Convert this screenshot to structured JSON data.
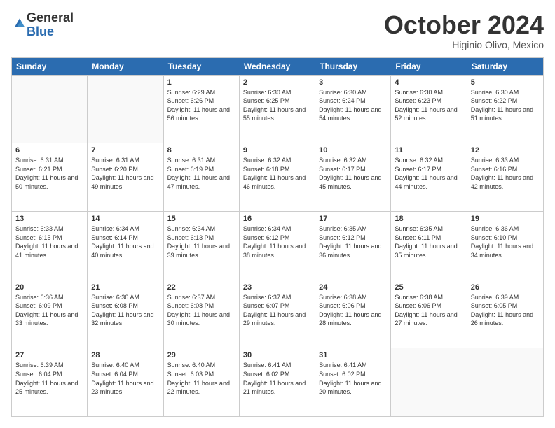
{
  "logo": {
    "general": "General",
    "blue": "Blue"
  },
  "title": "October 2024",
  "location": "Higinio Olivo, Mexico",
  "header_days": [
    "Sunday",
    "Monday",
    "Tuesday",
    "Wednesday",
    "Thursday",
    "Friday",
    "Saturday"
  ],
  "rows": [
    [
      {
        "day": "",
        "info": "",
        "empty": true
      },
      {
        "day": "",
        "info": "",
        "empty": true
      },
      {
        "day": "1",
        "info": "Sunrise: 6:29 AM\nSunset: 6:26 PM\nDaylight: 11 hours and 56 minutes."
      },
      {
        "day": "2",
        "info": "Sunrise: 6:30 AM\nSunset: 6:25 PM\nDaylight: 11 hours and 55 minutes."
      },
      {
        "day": "3",
        "info": "Sunrise: 6:30 AM\nSunset: 6:24 PM\nDaylight: 11 hours and 54 minutes."
      },
      {
        "day": "4",
        "info": "Sunrise: 6:30 AM\nSunset: 6:23 PM\nDaylight: 11 hours and 52 minutes."
      },
      {
        "day": "5",
        "info": "Sunrise: 6:30 AM\nSunset: 6:22 PM\nDaylight: 11 hours and 51 minutes."
      }
    ],
    [
      {
        "day": "6",
        "info": "Sunrise: 6:31 AM\nSunset: 6:21 PM\nDaylight: 11 hours and 50 minutes."
      },
      {
        "day": "7",
        "info": "Sunrise: 6:31 AM\nSunset: 6:20 PM\nDaylight: 11 hours and 49 minutes."
      },
      {
        "day": "8",
        "info": "Sunrise: 6:31 AM\nSunset: 6:19 PM\nDaylight: 11 hours and 47 minutes."
      },
      {
        "day": "9",
        "info": "Sunrise: 6:32 AM\nSunset: 6:18 PM\nDaylight: 11 hours and 46 minutes."
      },
      {
        "day": "10",
        "info": "Sunrise: 6:32 AM\nSunset: 6:17 PM\nDaylight: 11 hours and 45 minutes."
      },
      {
        "day": "11",
        "info": "Sunrise: 6:32 AM\nSunset: 6:17 PM\nDaylight: 11 hours and 44 minutes."
      },
      {
        "day": "12",
        "info": "Sunrise: 6:33 AM\nSunset: 6:16 PM\nDaylight: 11 hours and 42 minutes."
      }
    ],
    [
      {
        "day": "13",
        "info": "Sunrise: 6:33 AM\nSunset: 6:15 PM\nDaylight: 11 hours and 41 minutes."
      },
      {
        "day": "14",
        "info": "Sunrise: 6:34 AM\nSunset: 6:14 PM\nDaylight: 11 hours and 40 minutes."
      },
      {
        "day": "15",
        "info": "Sunrise: 6:34 AM\nSunset: 6:13 PM\nDaylight: 11 hours and 39 minutes."
      },
      {
        "day": "16",
        "info": "Sunrise: 6:34 AM\nSunset: 6:12 PM\nDaylight: 11 hours and 38 minutes."
      },
      {
        "day": "17",
        "info": "Sunrise: 6:35 AM\nSunset: 6:12 PM\nDaylight: 11 hours and 36 minutes."
      },
      {
        "day": "18",
        "info": "Sunrise: 6:35 AM\nSunset: 6:11 PM\nDaylight: 11 hours and 35 minutes."
      },
      {
        "day": "19",
        "info": "Sunrise: 6:36 AM\nSunset: 6:10 PM\nDaylight: 11 hours and 34 minutes."
      }
    ],
    [
      {
        "day": "20",
        "info": "Sunrise: 6:36 AM\nSunset: 6:09 PM\nDaylight: 11 hours and 33 minutes."
      },
      {
        "day": "21",
        "info": "Sunrise: 6:36 AM\nSunset: 6:08 PM\nDaylight: 11 hours and 32 minutes."
      },
      {
        "day": "22",
        "info": "Sunrise: 6:37 AM\nSunset: 6:08 PM\nDaylight: 11 hours and 30 minutes."
      },
      {
        "day": "23",
        "info": "Sunrise: 6:37 AM\nSunset: 6:07 PM\nDaylight: 11 hours and 29 minutes."
      },
      {
        "day": "24",
        "info": "Sunrise: 6:38 AM\nSunset: 6:06 PM\nDaylight: 11 hours and 28 minutes."
      },
      {
        "day": "25",
        "info": "Sunrise: 6:38 AM\nSunset: 6:06 PM\nDaylight: 11 hours and 27 minutes."
      },
      {
        "day": "26",
        "info": "Sunrise: 6:39 AM\nSunset: 6:05 PM\nDaylight: 11 hours and 26 minutes."
      }
    ],
    [
      {
        "day": "27",
        "info": "Sunrise: 6:39 AM\nSunset: 6:04 PM\nDaylight: 11 hours and 25 minutes."
      },
      {
        "day": "28",
        "info": "Sunrise: 6:40 AM\nSunset: 6:04 PM\nDaylight: 11 hours and 23 minutes."
      },
      {
        "day": "29",
        "info": "Sunrise: 6:40 AM\nSunset: 6:03 PM\nDaylight: 11 hours and 22 minutes."
      },
      {
        "day": "30",
        "info": "Sunrise: 6:41 AM\nSunset: 6:02 PM\nDaylight: 11 hours and 21 minutes."
      },
      {
        "day": "31",
        "info": "Sunrise: 6:41 AM\nSunset: 6:02 PM\nDaylight: 11 hours and 20 minutes."
      },
      {
        "day": "",
        "info": "",
        "empty": true
      },
      {
        "day": "",
        "info": "",
        "empty": true
      }
    ]
  ]
}
